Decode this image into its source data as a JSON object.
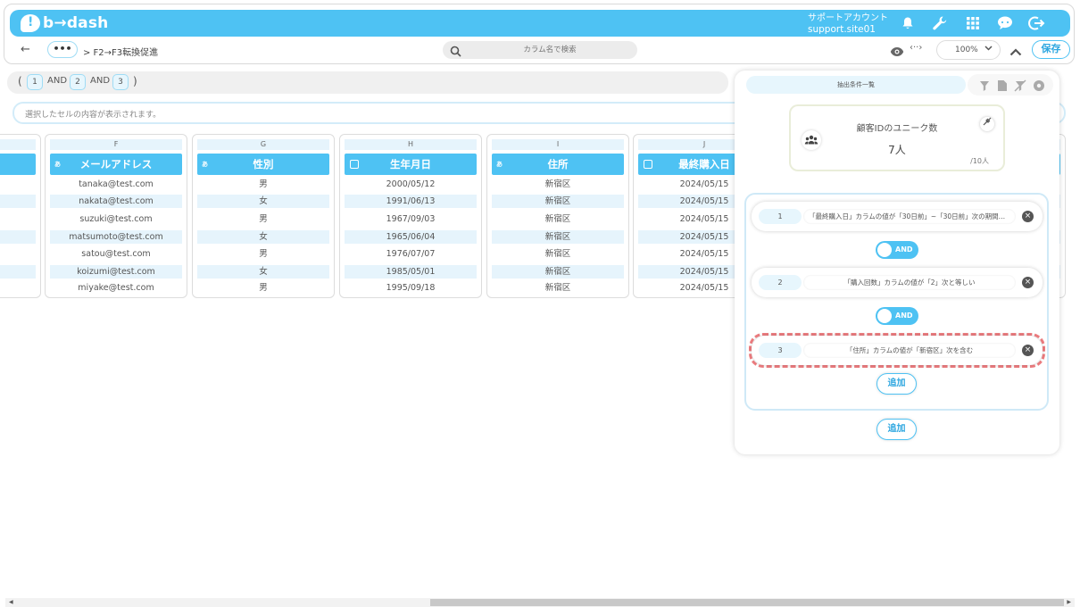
{
  "header": {
    "logo_text": "b→dash",
    "account_label": "サポートアカウント",
    "account_id": "support.site01",
    "icons": [
      "bell-icon",
      "wrench-icon",
      "grid-icon",
      "chat-icon",
      "logout-icon"
    ],
    "brand_color": "#4ec2f3"
  },
  "subbar": {
    "back": "←",
    "more": "•••",
    "breadcrumb": "> F2→F3転換促進",
    "search_placeholder": "カラム名で検索",
    "zoom": "100%",
    "save": "保存"
  },
  "conditions_line": {
    "open": "(",
    "close": ")",
    "items": [
      "1",
      "2",
      "3"
    ],
    "op": "AND"
  },
  "cell_bar": "選択したセルの内容が表示されます。",
  "columns": [
    {
      "letter": "F",
      "name": "メールアドレス",
      "type": "text",
      "cells": [
        "tanaka@test.com",
        "nakata@test.com",
        "suzuki@test.com",
        "matsumoto@test.com",
        "satou@test.com",
        "koizumi@test.com",
        "miyake@test.com"
      ]
    },
    {
      "letter": "G",
      "name": "性別",
      "type": "text",
      "cells": [
        "男",
        "女",
        "男",
        "女",
        "男",
        "女",
        "男"
      ]
    },
    {
      "letter": "H",
      "name": "生年月日",
      "type": "date",
      "cells": [
        "2000/05/12",
        "1991/06/13",
        "1967/09/03",
        "1965/06/04",
        "1976/07/07",
        "1985/05/01",
        "1995/09/18"
      ]
    },
    {
      "letter": "I",
      "name": "住所",
      "type": "text",
      "cells": [
        "新宿区",
        "新宿区",
        "新宿区",
        "新宿区",
        "新宿区",
        "新宿区",
        "新宿区"
      ]
    },
    {
      "letter": "J",
      "name": "最終購入日",
      "type": "date",
      "cells": [
        "2024/05/15",
        "2024/05/15",
        "2024/05/15",
        "2024/05/15",
        "2024/05/15",
        "2024/05/15",
        "2024/05/15"
      ]
    }
  ],
  "type_tag": "あ",
  "panel": {
    "tab": "抽出条件一覧",
    "unique_title": "顧客IDのユニーク数",
    "unique_value": "7人",
    "unique_total": "/10人",
    "conditions": [
      {
        "num": "1",
        "text": "「最終購入日」カラムの値が「30日前」~「30日前」次の期間に..."
      },
      {
        "num": "2",
        "text": "「購入回数」カラムの値が「2」次と等しい"
      },
      {
        "num": "3",
        "text": "「住所」カラムの値が「新宿区」次を含む"
      }
    ],
    "and_label": "AND",
    "add_label": "追加",
    "highlight_color": "#ee7d80"
  }
}
